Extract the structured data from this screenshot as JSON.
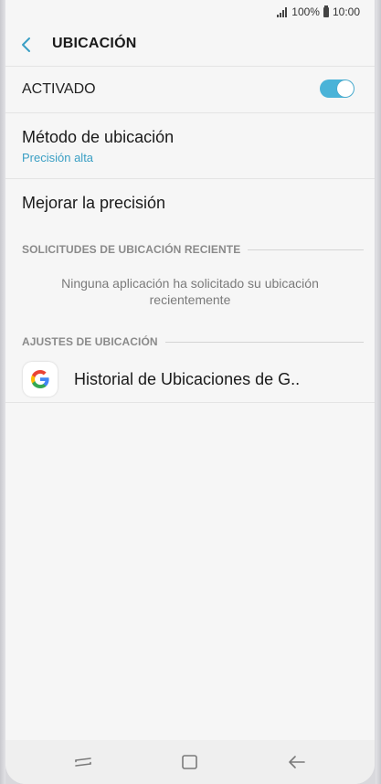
{
  "status_bar": {
    "battery": "100%",
    "time": "10:00"
  },
  "header": {
    "title": "UBICACIÓN"
  },
  "activated": {
    "label": "ACTIVADO",
    "toggle_on": true,
    "accent_color": "#4ab3d8"
  },
  "method": {
    "title": "Método de ubicación",
    "value": "Precisión alta"
  },
  "improve": {
    "title": "Mejorar la precisión"
  },
  "recent_requests": {
    "header": "SOLICITUDES DE UBICACIÓN RECIENTE",
    "empty_message": "Ninguna aplicación ha solicitado su ubicación recientemente"
  },
  "location_settings": {
    "header": "AJUSTES DE UBICACIÓN",
    "items": [
      {
        "icon": "google-icon",
        "label": "Historial de Ubicaciones de G.."
      }
    ]
  },
  "nav_bar": {
    "buttons": [
      "recent-apps-icon",
      "home-icon",
      "back-icon"
    ]
  }
}
